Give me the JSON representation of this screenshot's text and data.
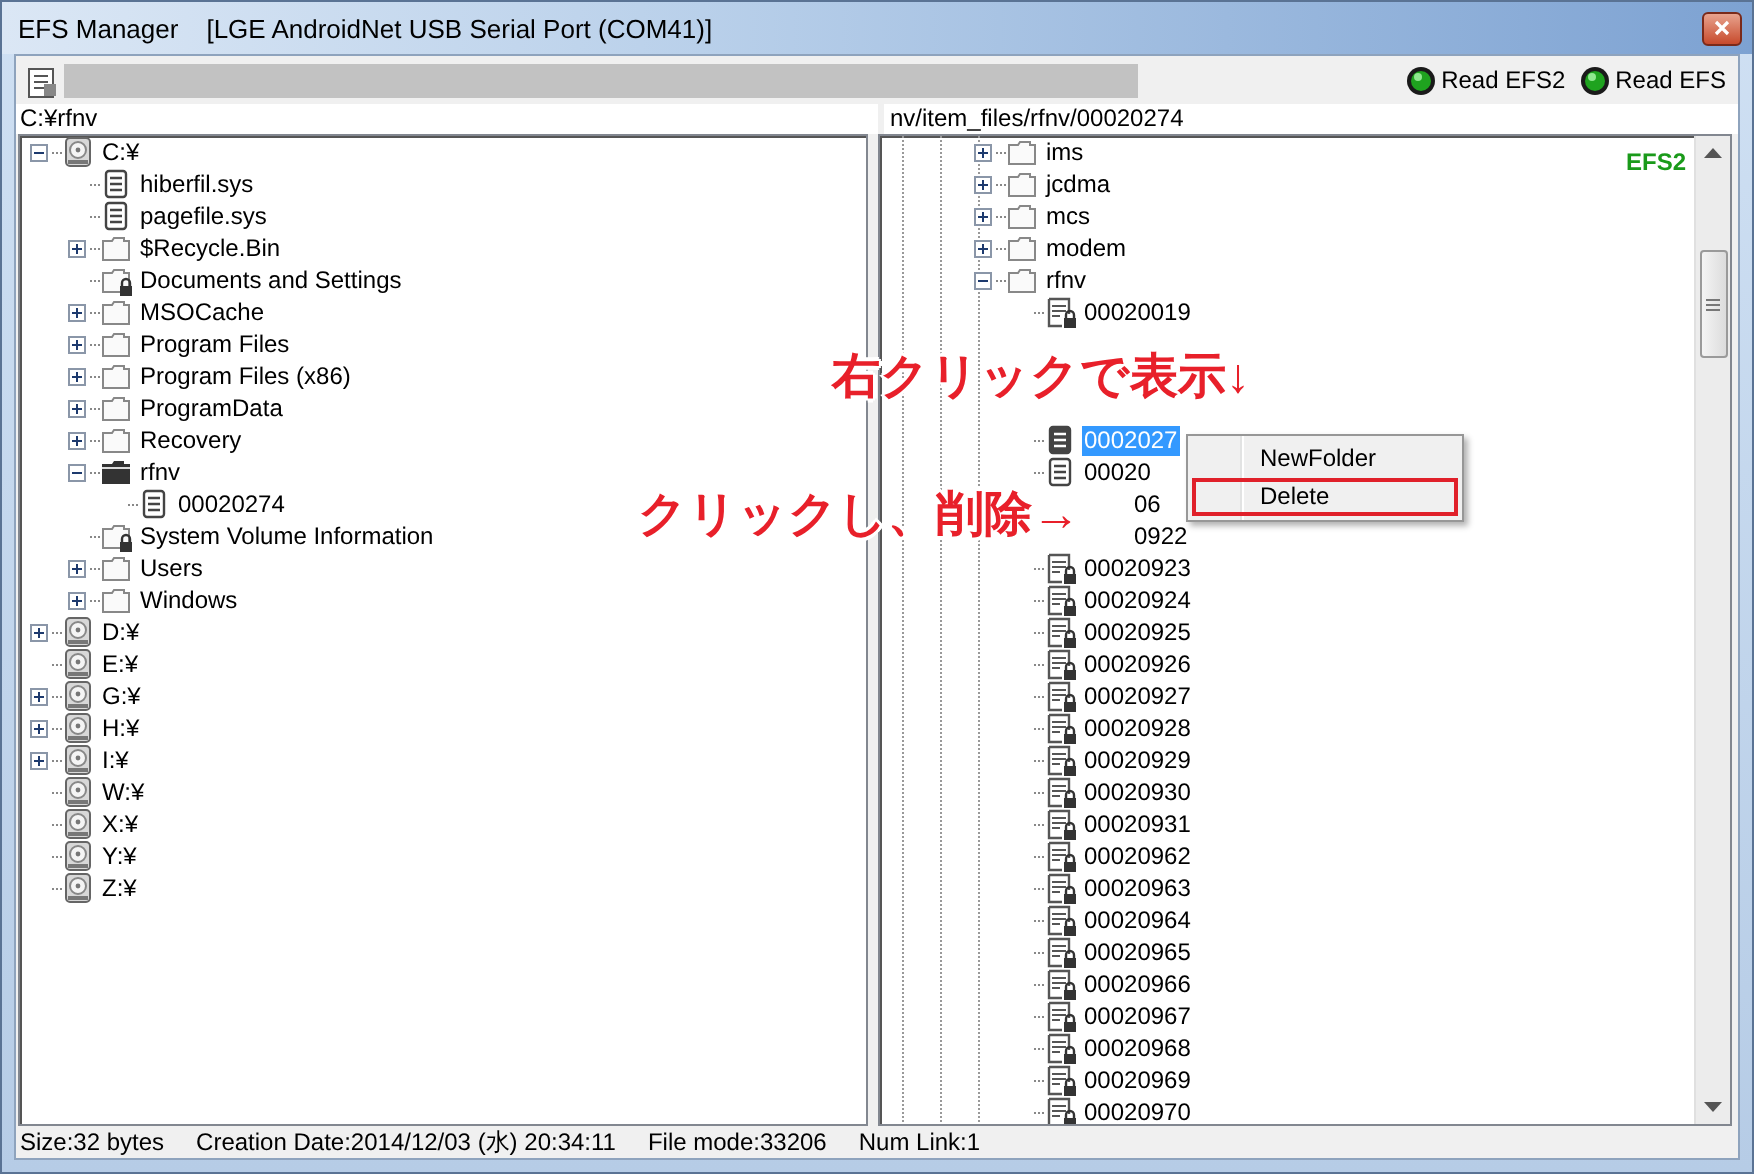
{
  "window": {
    "title": "EFS Manager",
    "subtitle": "[LGE AndroidNet USB Serial Port (COM41)]"
  },
  "toolbar": {
    "progress": {
      "level": 0
    },
    "buttons": [
      {
        "label": "Read EFS2"
      },
      {
        "label": "Read EFS"
      }
    ]
  },
  "left_path": "C:¥rfnv",
  "right_path": "nv/item_files/rfnv/00020274",
  "efs_badge": "EFS2",
  "left_tree": [
    {
      "label": "C:¥",
      "kind": "drive",
      "expanded": true,
      "children": [
        {
          "label": "hiberfil.sys",
          "kind": "file"
        },
        {
          "label": "pagefile.sys",
          "kind": "file"
        },
        {
          "label": "$Recycle.Bin",
          "kind": "folder",
          "expanded": false
        },
        {
          "label": "Documents and Settings",
          "kind": "locked-folder"
        },
        {
          "label": "MSOCache",
          "kind": "folder",
          "expanded": false
        },
        {
          "label": "Program Files",
          "kind": "folder",
          "expanded": false
        },
        {
          "label": "Program Files (x86)",
          "kind": "folder",
          "expanded": false
        },
        {
          "label": "ProgramData",
          "kind": "folder",
          "expanded": false
        },
        {
          "label": "Recovery",
          "kind": "folder",
          "expanded": false
        },
        {
          "label": "rfnv",
          "kind": "open-folder",
          "expanded": true,
          "children": [
            {
              "label": "00020274",
              "kind": "file"
            }
          ]
        },
        {
          "label": "System Volume Information",
          "kind": "locked-folder"
        },
        {
          "label": "Users",
          "kind": "folder",
          "expanded": false
        },
        {
          "label": "Windows",
          "kind": "folder",
          "expanded": false
        }
      ]
    },
    {
      "label": "D:¥",
      "kind": "drive",
      "expanded": false
    },
    {
      "label": "E:¥",
      "kind": "drive"
    },
    {
      "label": "G:¥",
      "kind": "drive",
      "expanded": false
    },
    {
      "label": "H:¥",
      "kind": "drive",
      "expanded": false
    },
    {
      "label": "I:¥",
      "kind": "drive",
      "expanded": false
    },
    {
      "label": "W:¥",
      "kind": "drive"
    },
    {
      "label": "X:¥",
      "kind": "drive"
    },
    {
      "label": "Y:¥",
      "kind": "drive"
    },
    {
      "label": "Z:¥",
      "kind": "drive"
    }
  ],
  "right_tree": [
    {
      "label": "ims",
      "kind": "folder",
      "expanded": false,
      "selected": false
    },
    {
      "label": "jcdma",
      "kind": "folder",
      "expanded": false,
      "selected": false
    },
    {
      "label": "mcs",
      "kind": "folder",
      "expanded": false,
      "selected": false
    },
    {
      "label": "modem",
      "kind": "folder",
      "expanded": false,
      "selected": false
    },
    {
      "label": "rfnv",
      "kind": "folder",
      "expanded": true,
      "selected": false,
      "children": [
        {
          "label": "00020019",
          "kind": "locked-file",
          "selected": false
        },
        {
          "kind": "blank"
        },
        {
          "kind": "blank"
        },
        {
          "kind": "blank"
        },
        {
          "label": "0002027",
          "kind": "file",
          "selected": true
        },
        {
          "label": "00020",
          "kind": "file",
          "selected": false
        },
        {
          "label": "06",
          "kind": "fragment",
          "selected": false
        },
        {
          "label": "0922",
          "kind": "fragment",
          "selected": false
        },
        {
          "label": "00020923",
          "kind": "locked-file",
          "selected": false
        },
        {
          "label": "00020924",
          "kind": "locked-file",
          "selected": false
        },
        {
          "label": "00020925",
          "kind": "locked-file",
          "selected": false
        },
        {
          "label": "00020926",
          "kind": "locked-file",
          "selected": false
        },
        {
          "label": "00020927",
          "kind": "locked-file",
          "selected": false
        },
        {
          "label": "00020928",
          "kind": "locked-file",
          "selected": false
        },
        {
          "label": "00020929",
          "kind": "locked-file",
          "selected": false
        },
        {
          "label": "00020930",
          "kind": "locked-file",
          "selected": false
        },
        {
          "label": "00020931",
          "kind": "locked-file",
          "selected": false
        },
        {
          "label": "00020962",
          "kind": "locked-file",
          "selected": false
        },
        {
          "label": "00020963",
          "kind": "locked-file",
          "selected": false
        },
        {
          "label": "00020964",
          "kind": "locked-file",
          "selected": false
        },
        {
          "label": "00020965",
          "kind": "locked-file",
          "selected": false
        },
        {
          "label": "00020966",
          "kind": "locked-file",
          "selected": false
        },
        {
          "label": "00020967",
          "kind": "locked-file",
          "selected": false
        },
        {
          "label": "00020968",
          "kind": "locked-file",
          "selected": false
        },
        {
          "label": "00020969",
          "kind": "locked-file",
          "selected": false
        },
        {
          "label": "00020970",
          "kind": "locked-file",
          "selected": false
        }
      ]
    }
  ],
  "context_menu": [
    {
      "label": "NewFolder",
      "highlighted": false
    },
    {
      "label": "Delete",
      "highlighted": true
    }
  ],
  "annotations": [
    {
      "text": "右クリックで表示↓",
      "kind": "above"
    },
    {
      "text": "クリックし、削除→",
      "kind": "left"
    }
  ],
  "status_bar": [
    "Size:32 bytes",
    "Creation Date:2014/12/03 (水) 20:34:11",
    "File mode:33206",
    "Num Link:1"
  ]
}
